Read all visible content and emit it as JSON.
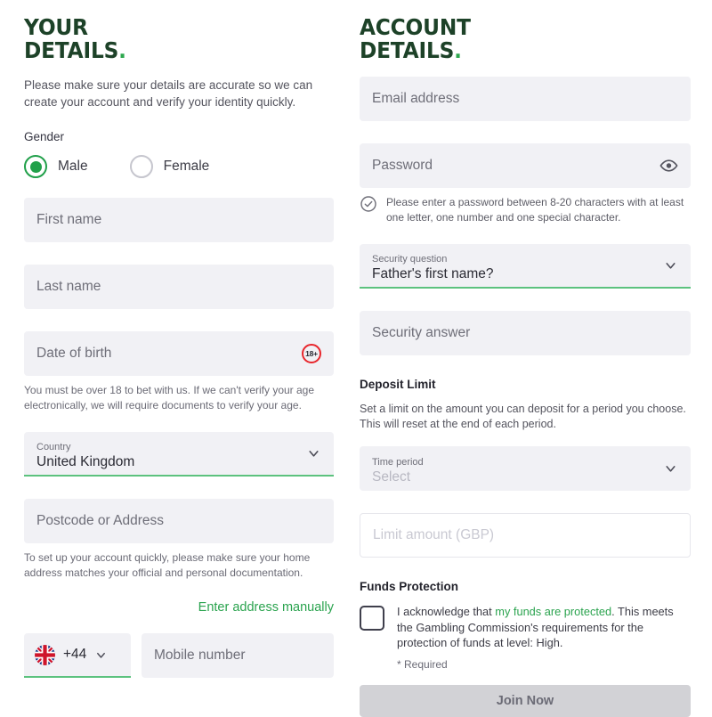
{
  "left": {
    "heading_line1": "YOUR",
    "heading_line2": "DETAILS",
    "heading_dot": ".",
    "intro": "Please make sure your details are accurate so we can create your account and verify your identity quickly.",
    "gender_label": "Gender",
    "gender_options": [
      {
        "label": "Male",
        "selected": true
      },
      {
        "label": "Female",
        "selected": false
      }
    ],
    "first_name_placeholder": "First name",
    "last_name_placeholder": "Last name",
    "dob_placeholder": "Date of birth",
    "dob_badge": "18+",
    "dob_helper": "You must be over 18 to bet with us. If we can't verify your age electronically, we will require documents to verify your age.",
    "country_label": "Country",
    "country_value": "United Kingdom",
    "postcode_placeholder": "Postcode or Address",
    "address_helper": "To set up your account quickly, please make sure your home address matches your official and personal documentation.",
    "enter_address_manually": "Enter address manually",
    "country_code": "+44",
    "mobile_placeholder": "Mobile number"
  },
  "right": {
    "heading_line1": "ACCOUNT",
    "heading_line2": "DETAILS",
    "heading_dot": ".",
    "email_placeholder": "Email address",
    "password_placeholder": "Password",
    "password_hint": "Please enter a password between 8-20 characters with at least one letter, one number and one special character.",
    "security_question_label": "Security question",
    "security_question_value": "Father's first name?",
    "security_answer_placeholder": "Security answer",
    "deposit_limit_title": "Deposit Limit",
    "deposit_limit_desc": "Set a limit on the amount you can deposit for a period you choose. This will reset at the end of each period.",
    "time_period_label": "Time period",
    "time_period_value": "Select",
    "limit_amount_placeholder": "Limit amount (GBP)",
    "funds_protection_title": "Funds Protection",
    "ack_prefix": "I acknowledge that ",
    "ack_link": "my funds are protected",
    "ack_suffix": ". This meets the Gambling Commission's requirements for the protection of funds at level: High.",
    "required_note": "* Required",
    "join_button": "Join Now"
  },
  "icons": {
    "chevron": "chevron-down-icon",
    "eye": "eye-icon",
    "check_circle": "check-circle-icon",
    "flag": "uk-flag-icon",
    "badge": "age-18-plus-icon"
  },
  "colors": {
    "heading_green": "#1d4228",
    "accent_green": "#2aa34e",
    "input_bg": "#f1f1f5",
    "underline_green": "#5cc27e",
    "badge_red": "#e8262c",
    "disabled_button": "#d2d2d6"
  }
}
